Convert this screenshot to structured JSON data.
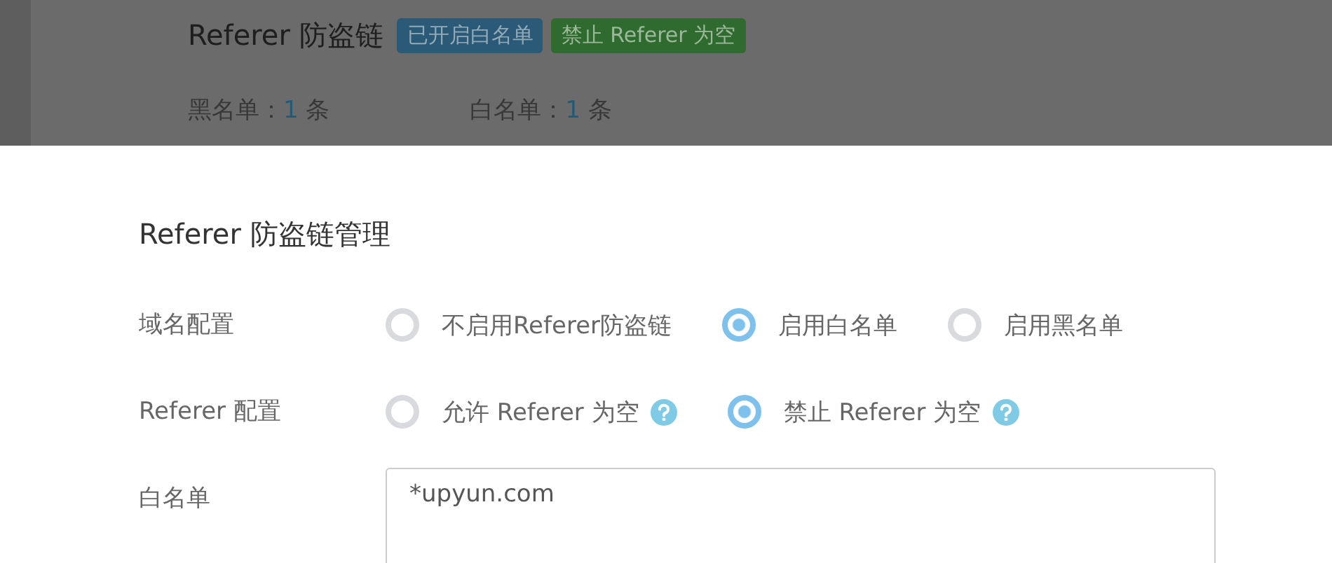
{
  "background": {
    "title": "Referer 防盗链",
    "badges": [
      {
        "text": "已开启白名单",
        "color": "#2a5a78"
      },
      {
        "text": "禁止 Referer 为空",
        "color": "#2f6a2e"
      }
    ],
    "counts": [
      {
        "label": "黑名单：",
        "value": "1",
        "unit": "条"
      },
      {
        "label": "白名单：",
        "value": "1",
        "unit": "条"
      }
    ]
  },
  "dialog": {
    "title": "Referer 防盗链管理",
    "fields": [
      {
        "label": "域名配置",
        "kind": "radio",
        "options": [
          {
            "label": "不启用Referer防盗链",
            "selected": false,
            "help": false
          },
          {
            "label": "启用白名单",
            "selected": true,
            "help": false
          },
          {
            "label": "启用黑名单",
            "selected": false,
            "help": false
          }
        ]
      },
      {
        "label": "Referer 配置",
        "kind": "radio",
        "options": [
          {
            "label": "允许 Referer 为空",
            "selected": false,
            "help": true
          },
          {
            "label": "禁止 Referer 为空",
            "selected": true,
            "help": true
          }
        ]
      },
      {
        "label": "白名单",
        "kind": "textarea",
        "value": "*upyun.com"
      }
    ]
  }
}
